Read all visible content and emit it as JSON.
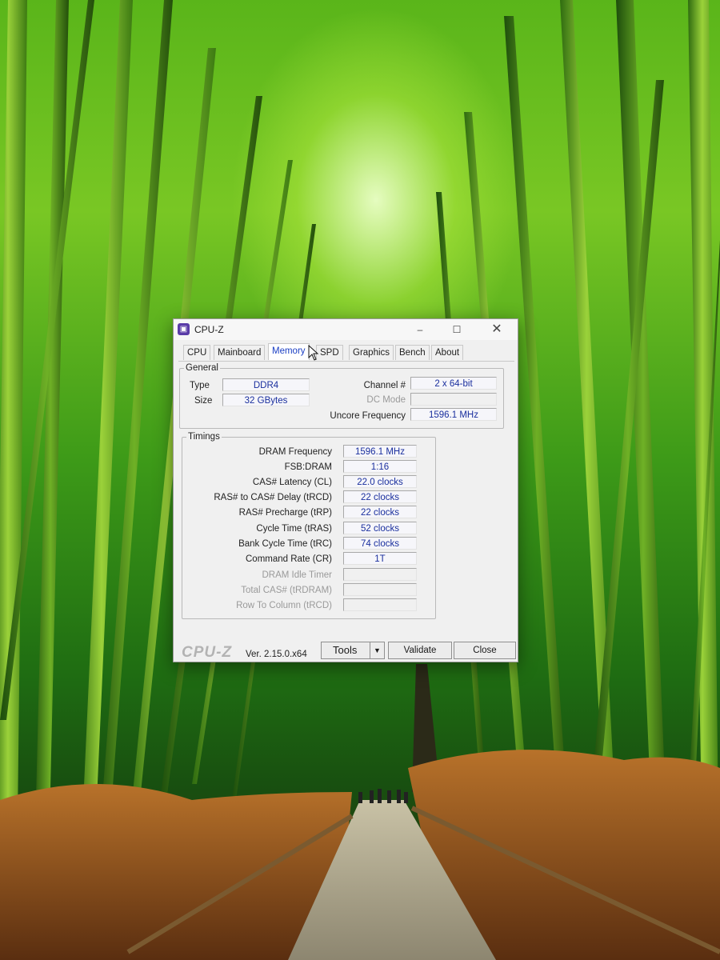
{
  "window": {
    "title": "CPU-Z",
    "icon": "cpuz-app-icon",
    "controls": {
      "minimize": "–",
      "maximize": "☐",
      "close": "✕"
    }
  },
  "tabs": [
    {
      "label": "CPU",
      "active": false
    },
    {
      "label": "Mainboard",
      "active": false
    },
    {
      "label": "Memory",
      "active": true
    },
    {
      "label": "SPD",
      "active": false
    },
    {
      "label": "Graphics",
      "active": false
    },
    {
      "label": "Bench",
      "active": false
    },
    {
      "label": "About",
      "active": false
    }
  ],
  "general": {
    "legend": "General",
    "type_label": "Type",
    "type_value": "DDR4",
    "size_label": "Size",
    "size_value": "32 GBytes",
    "channel_label": "Channel #",
    "channel_value": "2 x 64-bit",
    "dc_mode_label": "DC Mode",
    "dc_mode_value": "",
    "uncore_label": "Uncore Frequency",
    "uncore_value": "1596.1 MHz"
  },
  "timings": {
    "legend": "Timings",
    "rows": [
      {
        "label": "DRAM Frequency",
        "value": "1596.1 MHz",
        "enabled": true
      },
      {
        "label": "FSB:DRAM",
        "value": "1:16",
        "enabled": true
      },
      {
        "label": "CAS# Latency (CL)",
        "value": "22.0 clocks",
        "enabled": true
      },
      {
        "label": "RAS# to CAS# Delay (tRCD)",
        "value": "22 clocks",
        "enabled": true
      },
      {
        "label": "RAS# Precharge (tRP)",
        "value": "22 clocks",
        "enabled": true
      },
      {
        "label": "Cycle Time (tRAS)",
        "value": "52 clocks",
        "enabled": true
      },
      {
        "label": "Bank Cycle Time (tRC)",
        "value": "74 clocks",
        "enabled": true
      },
      {
        "label": "Command Rate (CR)",
        "value": "1T",
        "enabled": true
      },
      {
        "label": "DRAM Idle Timer",
        "value": "",
        "enabled": false
      },
      {
        "label": "Total CAS# (tRDRAM)",
        "value": "",
        "enabled": false
      },
      {
        "label": "Row To Column (tRCD)",
        "value": "",
        "enabled": false
      }
    ]
  },
  "footer": {
    "brand": "CPU-Z",
    "version": "Ver. 2.15.0.x64",
    "tools_label": "Tools",
    "validate_label": "Validate",
    "close_label": "Close"
  },
  "colors": {
    "value_text": "#1a2f9e",
    "active_tab_text": "#1a3ec4",
    "window_bg": "#f0f0f0"
  }
}
